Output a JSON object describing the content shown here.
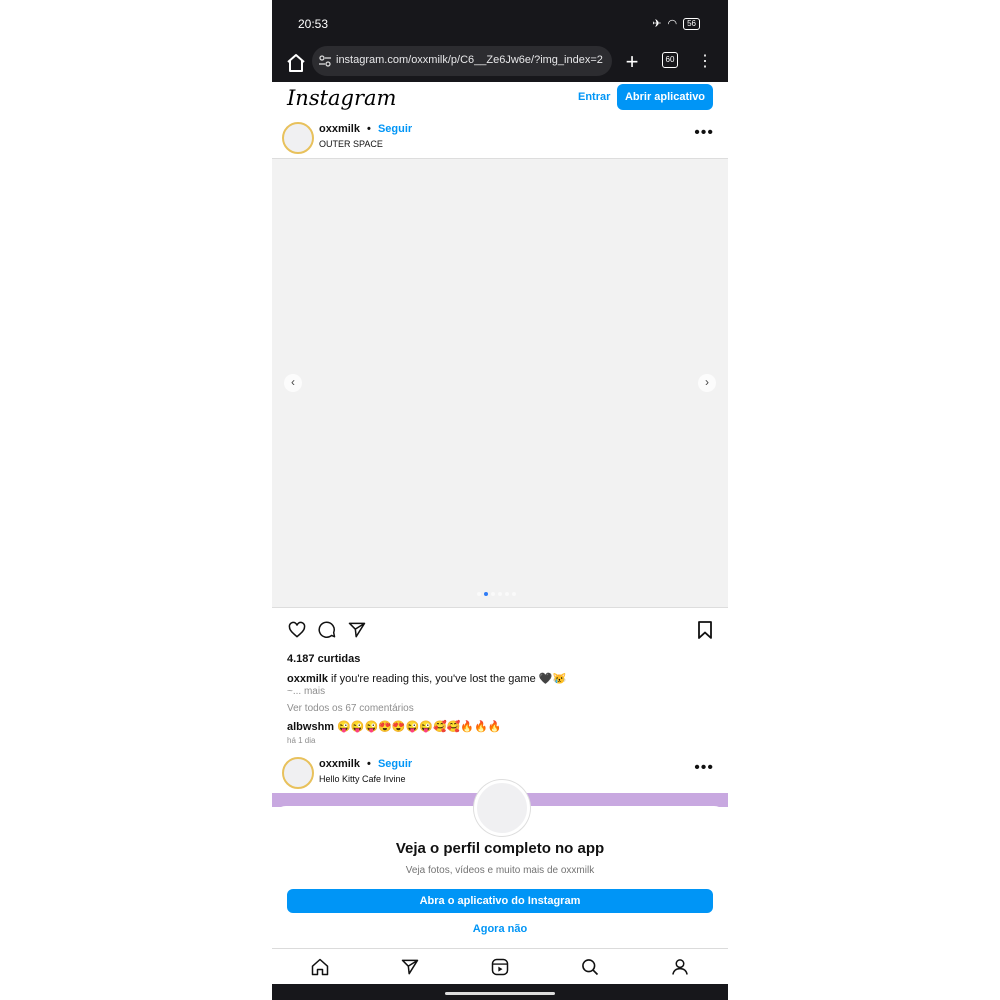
{
  "status_bar": {
    "time": "20:53",
    "battery": "56"
  },
  "browser": {
    "url": "instagram.com/oxxmilk/p/C6__Ze6Jw6e/?img_index=2",
    "tab_count": "60"
  },
  "header": {
    "logo": "Instagram",
    "login_label": "Entrar",
    "open_app_label": "Abrir aplicativo"
  },
  "post": {
    "username": "oxxmilk",
    "separator": "•",
    "follow_label": "Seguir",
    "location": "OUTER SPACE",
    "carousel": {
      "index": 2,
      "count": 6
    },
    "likes": "4.187 curtidas",
    "caption_user": "oxxmilk",
    "caption_text": "if you're reading this, you've lost the game 🖤😿",
    "more_label": "~... mais",
    "view_comments": "Ver todos os 67 comentários",
    "comment_user": "albwshm",
    "comment_text": "😜😜😜😍😍😜😜🥰🥰🔥🔥🔥",
    "time_ago": "há 1 dia"
  },
  "next_post": {
    "username": "oxxmilk",
    "separator": "•",
    "follow_label": "Seguir",
    "location": "Hello Kitty Cafe Irvine"
  },
  "sheet": {
    "title": "Veja o perfil completo no app",
    "subtitle": "Veja fotos, vídeos e muito mais de oxxmilk",
    "cta_label": "Abra o aplicativo do Instagram",
    "dismiss_label": "Agora não"
  },
  "colors": {
    "accent": "#0095f6",
    "dark_bar": "#17171b"
  }
}
